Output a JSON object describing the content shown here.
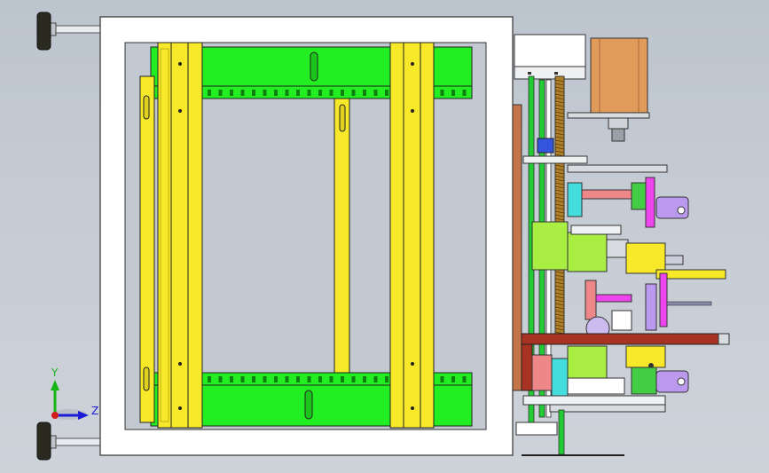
{
  "viewport": {
    "name": "cad-3d-viewport",
    "background_top": "#bcc4ce",
    "background_bottom": "#ced3da"
  },
  "triad": {
    "y_label": "Y",
    "z_label": "Z",
    "y_color": "#17b417",
    "z_color": "#1b1bd6",
    "x_color": "#d41e1e"
  },
  "colors": {
    "frame_white": "#ffffff",
    "rail_green": "#22ee22",
    "bar_yellow": "#f7e82a",
    "motor_orange": "#e09a5a",
    "beam_red": "#a83322",
    "part_lime": "#aaee44",
    "part_magenta": "#ee44ee",
    "part_violet": "#bb99ee",
    "part_cyan": "#44dddd",
    "part_pink": "#ee8888",
    "outline": "#222222"
  }
}
